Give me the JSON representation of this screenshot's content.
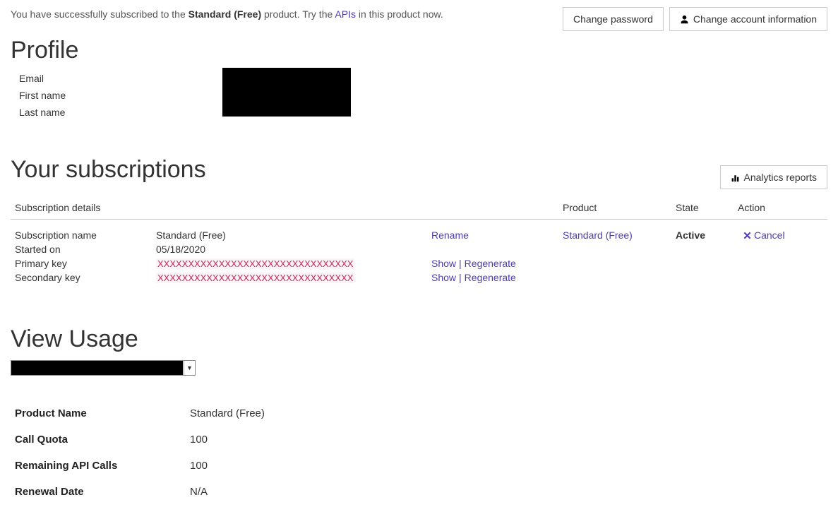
{
  "notice": {
    "prefix": "You have successfully subscribed to the ",
    "product": "Standard (Free)",
    "middle": " product. Try the ",
    "link": "APIs",
    "suffix": " in this product now."
  },
  "buttons": {
    "change_password": "Change password",
    "change_account": "Change account information",
    "analytics_reports": "Analytics reports"
  },
  "headings": {
    "profile": "Profile",
    "subscriptions": "Your subscriptions",
    "usage": "View Usage"
  },
  "profile": {
    "email_label": "Email",
    "firstname_label": "First name",
    "lastname_label": "Last name"
  },
  "subs": {
    "headers": {
      "details": "Subscription details",
      "product": "Product",
      "state": "State",
      "action": "Action"
    },
    "labels": {
      "sub_name": "Subscription name",
      "started_on": "Started on",
      "primary_key": "Primary key",
      "secondary_key": "Secondary key"
    },
    "values": {
      "sub_name": "Standard (Free)",
      "started_on": "05/18/2020",
      "primary_key": "XXXXXXXXXXXXXXXXXXXXXXXXXXXXXXXX",
      "secondary_key": "XXXXXXXXXXXXXXXXXXXXXXXXXXXXXXXX"
    },
    "links": {
      "rename": "Rename",
      "show": "Show",
      "regenerate": "Regenerate",
      "cancel": "Cancel"
    },
    "product": "Standard (Free)",
    "state": "Active"
  },
  "usage": {
    "labels": {
      "product_name": "Product Name",
      "call_quota": "Call Quota",
      "remaining": "Remaining API Calls",
      "renewal": "Renewal Date"
    },
    "values": {
      "product_name": "Standard (Free)",
      "call_quota": "100",
      "remaining": "100",
      "renewal": "N/A"
    }
  }
}
